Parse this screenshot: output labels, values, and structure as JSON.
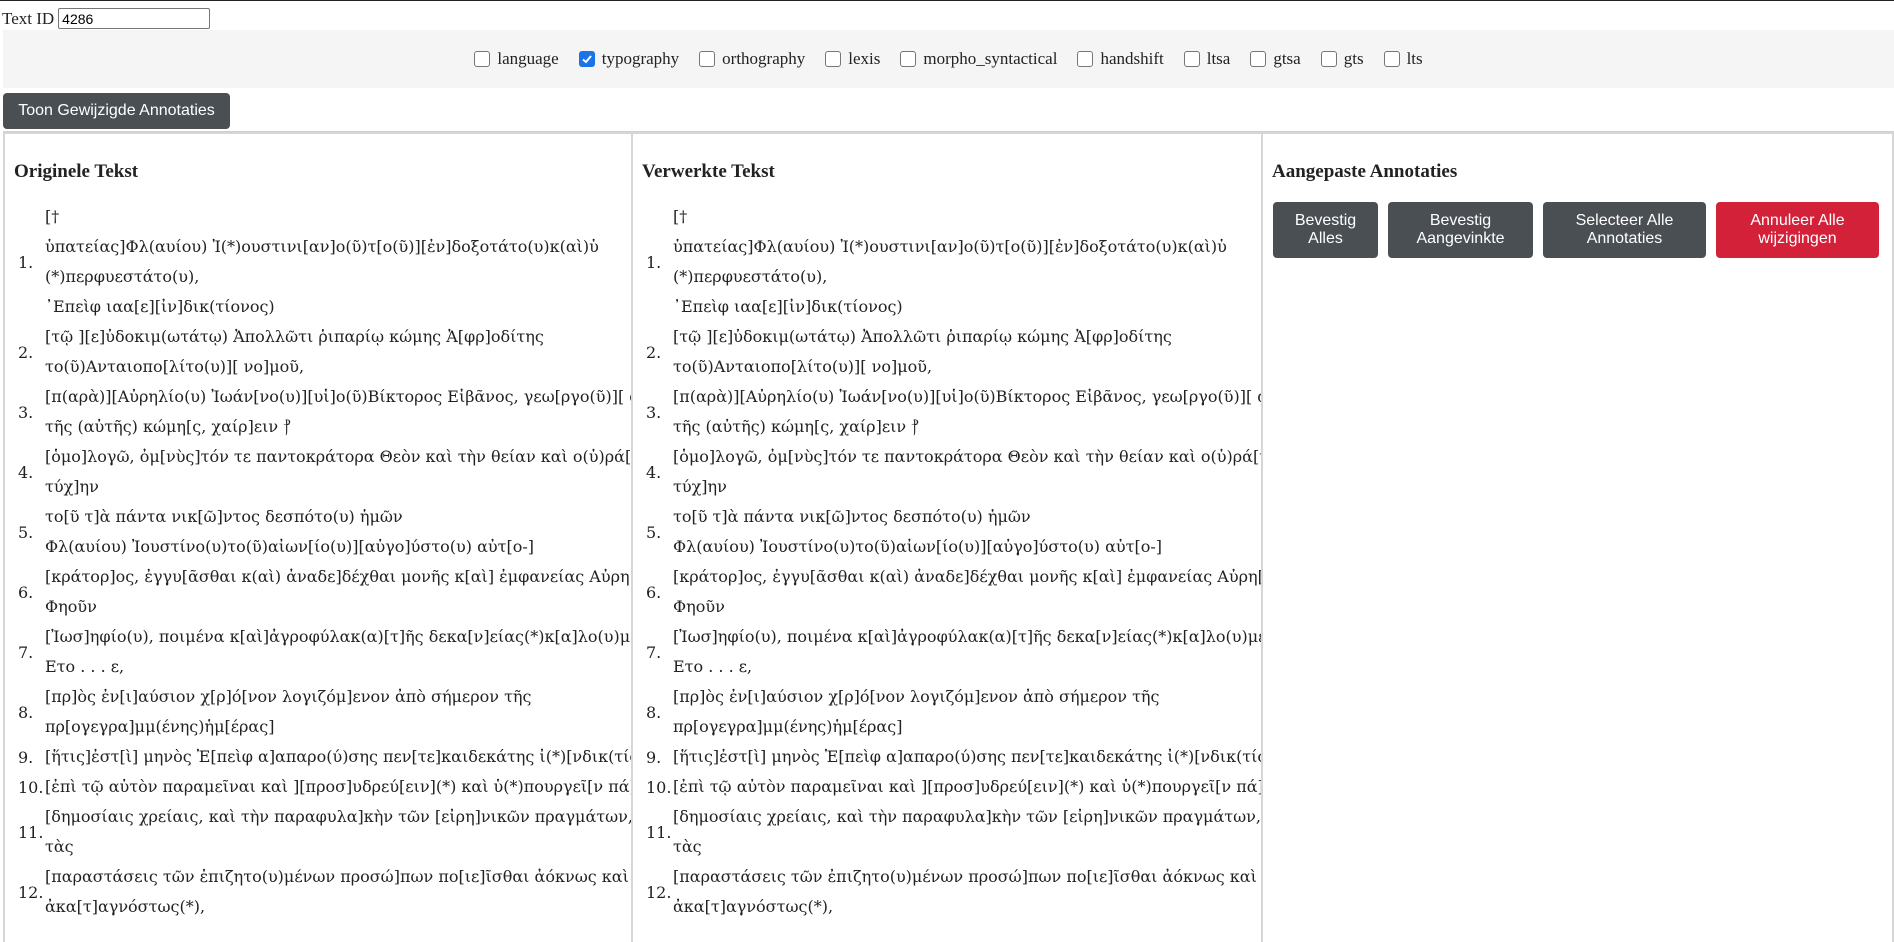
{
  "text_id": {
    "label": "Text ID",
    "value": "4286"
  },
  "filters": [
    {
      "label": "language",
      "checked": false
    },
    {
      "label": "typography",
      "checked": true
    },
    {
      "label": "orthography",
      "checked": false
    },
    {
      "label": "lexis",
      "checked": false
    },
    {
      "label": "morpho_syntactical",
      "checked": false
    },
    {
      "label": "handshift",
      "checked": false
    },
    {
      "label": "ltsa",
      "checked": false
    },
    {
      "label": "gtsa",
      "checked": false
    },
    {
      "label": "gts",
      "checked": false
    },
    {
      "label": "lts",
      "checked": false
    }
  ],
  "show_changed_button": "Toon Gewijzigde Annotaties",
  "panel_original": {
    "title": "Originele Tekst"
  },
  "panel_processed": {
    "title": "Verwerkte Tekst"
  },
  "panel_annotations": {
    "title": "Aangepaste Annotaties",
    "buttons": [
      {
        "label": "Bevestig Alles"
      },
      {
        "label": "Bevestig Aangevinkte"
      },
      {
        "label": "Selecteer Alle Annotaties"
      },
      {
        "label": "Annuleer Alle wijzigingen"
      }
    ]
  },
  "colors": {
    "highlight": "#f5b9bd",
    "highlight_strong": "#ef8a93",
    "danger": "#d3213a",
    "dark_button": "#4a4f54"
  },
  "lines": [
    {
      "num": "",
      "rows": [
        "[† "
      ]
    },
    {
      "num": "1.",
      "rows": [
        "ὑπατείας]Φλ(αυίου) Ἰ(*)ουστινι[αν]ο(ῦ)τ[ο(ῦ)][ἐν]δοξοτάτο(υ)κ(αὶ)ὑ",
        "(*)περφυεστάτο(υ),"
      ]
    },
    {
      "num": "",
      "rows": [
        "᾿Επεὶφ ιαα[ε][ἰν]δικ(τίονος)"
      ]
    },
    {
      "num": "2.",
      "rows": [
        "[τῷ ][ε]ὐδοκιμ(ωτάτῳ) Ἀπολλῶτι ῥιπαρίῳ κώμης Ἀ[φρ]οδίτης",
        "το(ῦ)Ανταιοπο[λίτο(υ)][ νο]μοῦ,"
      ]
    },
    {
      "num": "3.",
      "rows": [
        "[π(αρὰ)][Αὐρηλίο(υ) Ἰωάν[νο(υ)][υἱ]ο(ῦ)Βίκτορος Εἰβᾶνος, γεω[ργο(ῦ)][ ἀ]πὸ",
        "τῆς (αὐτῆς) κώμη[ς, χαίρ]ειν ⳨"
      ]
    },
    {
      "num": "4.",
      "rows": [
        "[ὁμο]λογῶ, ὀμ[νὺς]τόν τε παντοκράτορα Θεὸν καὶ τὴν θείαν καὶ ο(ὐ)ρά[νιον",
        "τύχ]ην"
      ]
    },
    {
      "num": "5.",
      "rows": [
        "το[ῦ τ]ὰ πάντα νικ[ῶ]ντος δεσπότο(υ) ἡμῶν",
        "Φλ(αυίου) Ἰουστίνο(υ)το(ῦ)αἰων[ίο(υ)][αὐγο]ύστο(υ) αὐτ[ο-]"
      ]
    },
    {
      "num": "6.",
      "rows": [
        "[κράτορ]ος, ἐγγυ[ᾶσθαι κ(αὶ) ἀναδε]δέχθαι μονῆς κ[αὶ] ἐμφανείας Αὐρη[λιο]ν",
        "Φηοῦν"
      ]
    },
    {
      "num": "7.",
      "rows": [
        "[Ἰωσ]ηφίο(υ), ποιμένα κ[αὶ]ἀγροφύλακ(α)[τ]ῆς δεκα[ν]είας(*)κ[α]λο(υ)μέν(ης)",
        "Ετο . . . ε,"
      ]
    },
    {
      "num": "8.",
      "rows": [
        "[πρ]ὸς ἐν[ι]αύσιον χ[ρ]ό[νον λογιζόμ]ενον ἀπὸ σήμερον τῆς",
        "πρ[ογεγρα]μμ(ένης)ἡμ[έρας]"
      ]
    },
    {
      "num": "9.",
      "rows": [
        "[ἥτις]ἐστ[ὶ] μηνὸς Ἐ[πεὶφ α]απαρο(ύ)σης πεν[τε]καιδεκάτης ἰ(*)[νδικ(τίονος)],"
      ]
    },
    {
      "num": "10.",
      "rows": [
        "[ἐπὶ τῷ αὐτὸν παραμεῖναι καὶ ][προσ]υδρεύ[ειν](*) καὶ ὑ(*)πουργεῖ[ν πά]σ[ι τα]ῖς"
      ]
    },
    {
      "num": "11.",
      "rows": [
        "[δημοσίαις χρείαις, καὶ τὴν παραφυλα]κὴν τῶν [εἰρη]νικῶν πραγμάτων, [κ(αὶ)]",
        "τὰς"
      ]
    },
    {
      "num": "12.",
      "rows": [
        "[παραστάσεις τῶν ἐπιζητο(υ)μένων προσώ]πων πο[ιε]ῖσθαι ἀόκνως καὶ",
        "ἀκα[τ]αγνόστως(*),"
      ]
    }
  ]
}
